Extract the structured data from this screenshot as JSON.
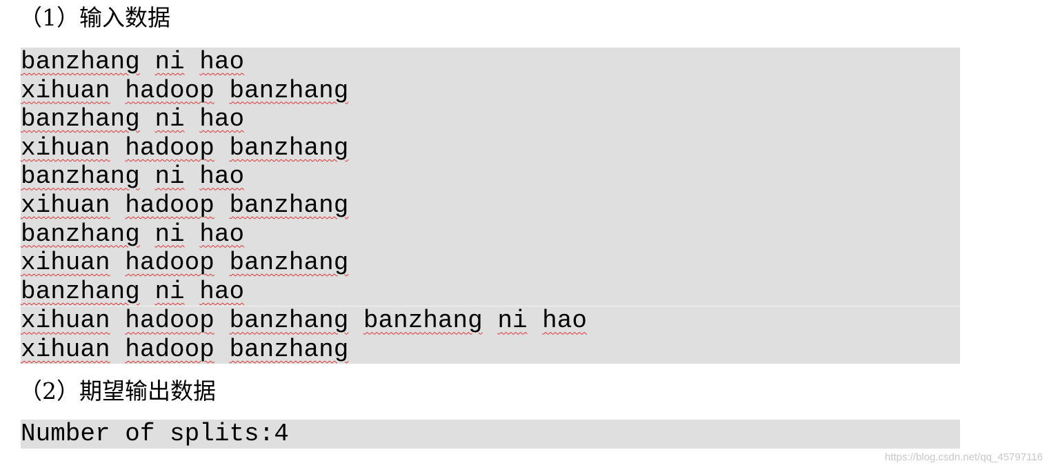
{
  "sections": [
    {
      "heading": "（1）输入数据",
      "lines": [
        [
          "banzhang",
          "ni",
          "hao"
        ],
        [
          "xihuan",
          "hadoop",
          "banzhang"
        ],
        [
          "banzhang",
          "ni",
          "hao"
        ],
        [
          "xihuan",
          "hadoop",
          "banzhang"
        ],
        [
          "banzhang",
          "ni",
          "hao"
        ],
        [
          "xihuan",
          "hadoop",
          "banzhang"
        ],
        [
          "banzhang",
          "ni",
          "hao"
        ],
        [
          "xihuan",
          "hadoop",
          "banzhang"
        ],
        [
          "banzhang",
          "ni",
          "hao"
        ],
        [
          "xihuan",
          "hadoop",
          "banzhang",
          "banzhang",
          "ni",
          "hao"
        ],
        [
          "xihuan",
          "hadoop",
          "banzhang"
        ]
      ]
    },
    {
      "heading": "（2）期望输出数据",
      "output": "Number of splits:4"
    }
  ],
  "watermark": "https://blog.csdn.net/qq_45797116",
  "colors": {
    "code_background": "#dfdfdf",
    "spellcheck_underline": "#e03030"
  }
}
